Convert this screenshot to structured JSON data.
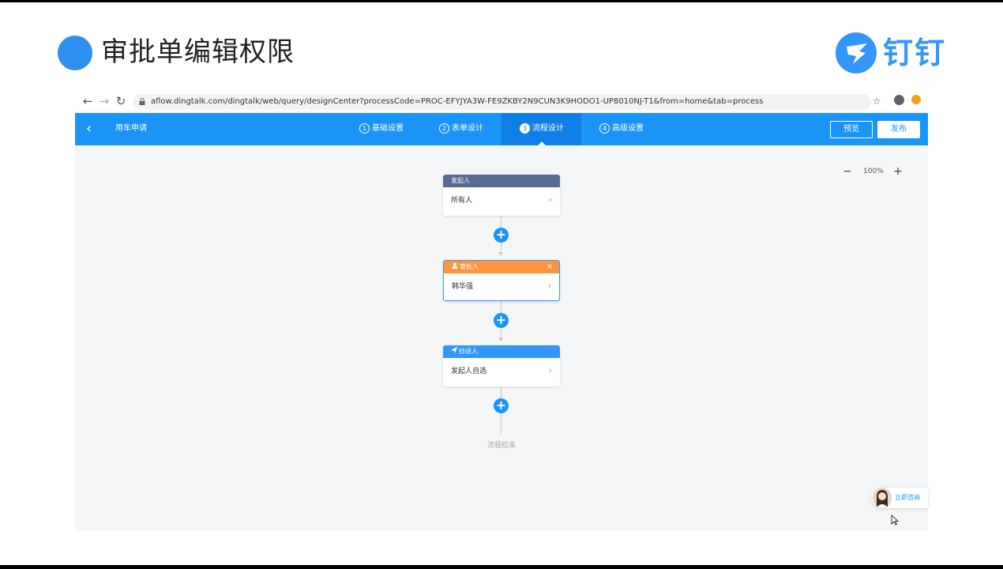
{
  "slide": {
    "title": "审批单编辑权限",
    "logo_text": "钉钉",
    "colors": {
      "accent": "#2f8ff0",
      "brand": "#3296fa"
    }
  },
  "browser": {
    "url": "aflow.dingtalk.com/dingtalk/web/query/designCenter?processCode=PROC-EFYJYA3W-FE9ZKBY2N9CUN3K9HODO1-UP8010NJ-T1&from=home&tab=process",
    "back_icon": "arrow-left-icon",
    "forward_icon": "arrow-right-icon",
    "reload_icon": "reload-icon",
    "lock_icon": "lock-icon",
    "star_icon": "star-icon",
    "profile_icon": "account-circle-icon",
    "extension_icon": "extension-icon"
  },
  "app": {
    "title": "用车申请",
    "header_color": "#1a94f9",
    "steps": [
      {
        "num": "1",
        "label": "基础设置",
        "active": false
      },
      {
        "num": "2",
        "label": "表单设计",
        "active": false
      },
      {
        "num": "3",
        "label": "流程设计",
        "active": true
      },
      {
        "num": "4",
        "label": "高级设置",
        "active": false
      }
    ],
    "preview_label": "预览",
    "publish_label": "发布"
  },
  "zoom": {
    "minus": "−",
    "value": "100%",
    "plus": "+"
  },
  "flow": {
    "nodes": [
      {
        "type": "initiator",
        "header": "发起人",
        "value": "所有人",
        "color": "#576a95"
      },
      {
        "type": "approver",
        "header": "审批人",
        "value": "韩华强",
        "color": "#ff943e",
        "selected": true
      },
      {
        "type": "cc",
        "header": "抄送人",
        "value": "发起人自选",
        "color": "#3296fa"
      }
    ],
    "add_label": "+",
    "end_label": "流程结束"
  },
  "consult": {
    "label": "立即咨询"
  }
}
